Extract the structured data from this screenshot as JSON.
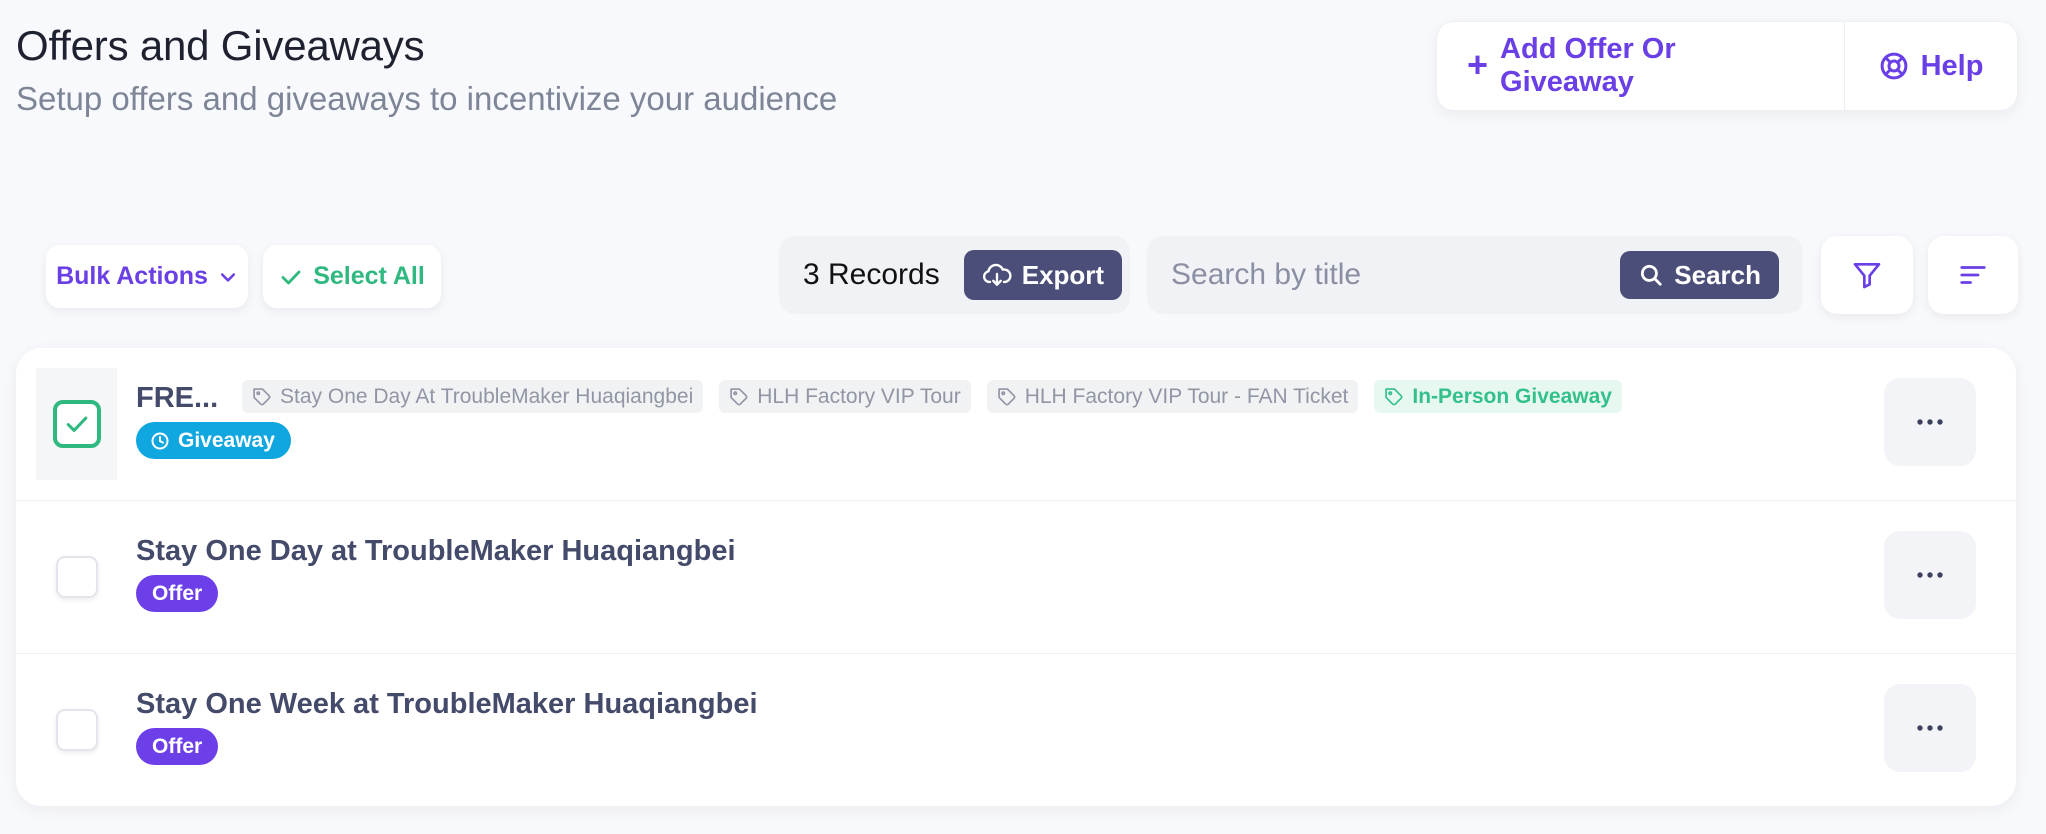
{
  "header": {
    "title": "Offers and Giveaways",
    "subtitle": "Setup offers and giveaways to incentivize your audience",
    "add_label": "Add Offer Or Giveaway",
    "help_label": "Help"
  },
  "toolbar": {
    "bulk_actions_label": "Bulk Actions",
    "select_all_label": "Select All",
    "records_label": "3 Records",
    "export_label": "Export",
    "search_placeholder": "Search by title",
    "search_value": "",
    "search_button_label": "Search"
  },
  "rows": [
    {
      "title": "FRE...",
      "selected": true,
      "tags": [
        {
          "label": "Stay One Day At TroubleMaker Huaqiangbei",
          "color": "#9196a5"
        },
        {
          "label": "HLH Factory VIP Tour",
          "color": "#9196a5"
        },
        {
          "label": "HLH Factory VIP Tour - FAN Ticket",
          "color": "#9196a5"
        },
        {
          "label": "In-Person Giveaway",
          "color": "#34c08b"
        }
      ],
      "badge": "Giveaway",
      "badge_color": "#10a6e0"
    },
    {
      "title": "Stay One Day at TroubleMaker Huaqiangbei",
      "selected": false,
      "tags": [],
      "badge": "Offer",
      "badge_color": "#6d3fe8"
    },
    {
      "title": "Stay One Week at TroubleMaker Huaqiangbei",
      "selected": false,
      "tags": [],
      "badge": "Offer",
      "badge_color": "#6d3fe8"
    }
  ],
  "colors": {
    "accent": "#6a3fe6",
    "success": "#2fb87f",
    "dark_button": "#4a4e78"
  },
  "icons": {
    "add": "plus-icon",
    "help": "lifebuoy-icon",
    "bulk": "chevron-down-icon",
    "select_all": "check-icon",
    "export": "cloud-download-icon",
    "search": "search-icon",
    "filter": "filter-icon",
    "sort": "sort-icon",
    "tag": "tag-icon",
    "giveaway": "clock-icon",
    "more": "more-horizontal-icon"
  }
}
